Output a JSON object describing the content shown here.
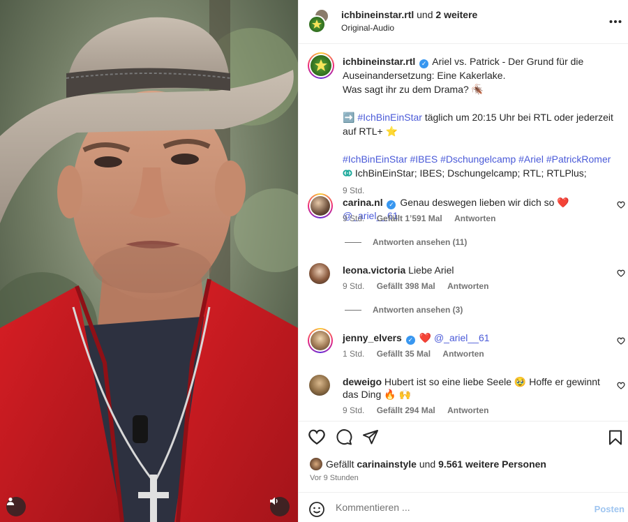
{
  "header": {
    "account": "ichbineinstar.rtl",
    "and_label": "und",
    "others": "2 weitere",
    "audio": "Original-Audio",
    "more_icon": "more-horizontal-icon"
  },
  "caption": {
    "username": "ichbineinstar.rtl",
    "line1": "Ariel vs. Patrick - Der Grund für die Auseinandersetzung: Eine Kakerlake.",
    "line2": "Was sagt ihr zu dem Drama? 🪳",
    "promo_arrow": "➡️",
    "promo_tag": "#IchBinEinStar",
    "promo_text": " täglich um 20:15 Uhr bei RTL oder jederzeit auf RTL+ ⭐",
    "hashtags": "#IchBinEinStar #IBES #Dschungelcamp #Ariel #PatrickRomer",
    "location": "IchBinEinStar; IBES; Dschungelcamp; RTL; RTLPlus;",
    "time": "9 Std."
  },
  "comments": [
    {
      "username": "carina.nl",
      "verified": true,
      "text": "Genau deswegen lieben wir dich so ❤️ ",
      "mention": "@_ariel__61",
      "time": "9 Std.",
      "likes": "Gefällt 1’591 Mal",
      "reply": "Antworten",
      "view_replies": "Antworten ansehen (11)"
    },
    {
      "username": "leona.victoria",
      "verified": false,
      "text": "Liebe Ariel",
      "mention": "",
      "time": "9 Std.",
      "likes": "Gefällt 398 Mal",
      "reply": "Antworten",
      "view_replies": "Antworten ansehen (3)"
    },
    {
      "username": "jenny_elvers",
      "verified": true,
      "text": "❤️ ",
      "mention": "@_ariel__61",
      "time": "1 Std.",
      "likes": "Gefällt 35 Mal",
      "reply": "Antworten",
      "view_replies": ""
    },
    {
      "username": "deweigo",
      "verified": false,
      "text": "Hubert ist so eine liebe Seele 🥹  Hoffe er gewinnt das Ding 🔥 🙌",
      "mention": "",
      "time": "9 Std.",
      "likes": "Gefällt 294 Mal",
      "reply": "Antworten",
      "view_replies": ""
    }
  ],
  "likes": {
    "prefix": "Gefällt",
    "user": "carinainstyle",
    "mid": "und",
    "count": "9.561 weitere Personen"
  },
  "post_time": "Vor 9 Stunden",
  "compose": {
    "placeholder": "Kommentieren ...",
    "post": "Posten"
  },
  "colors": {
    "link": "#4a5ad8",
    "verified": "#3897f0",
    "post_disabled": "#9fc5f0",
    "heart": "#ed1c4b"
  }
}
